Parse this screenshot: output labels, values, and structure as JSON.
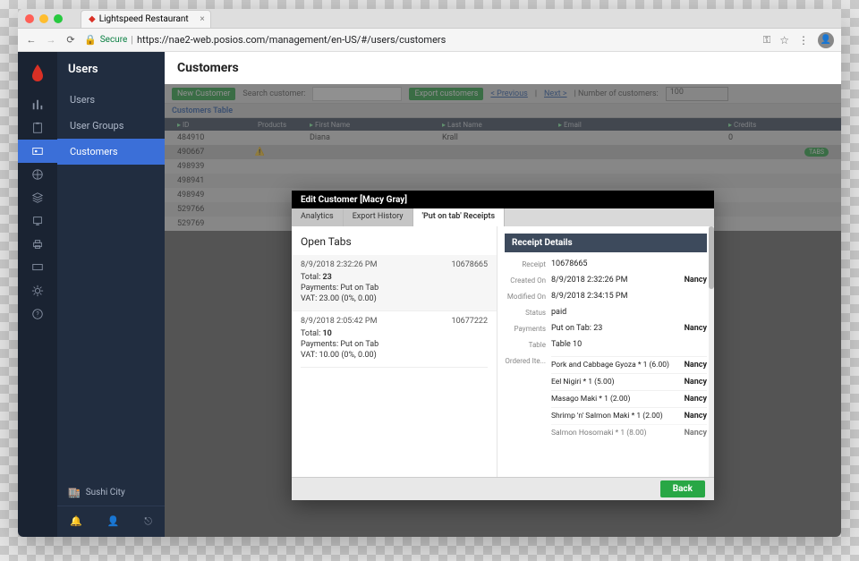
{
  "browser": {
    "tab_title": "Lightspeed Restaurant",
    "secure_label": "Secure",
    "url": "https://nae2-web.posios.com/management/en-US/#/users/customers"
  },
  "sidebar": {
    "title": "Users",
    "items": [
      "Users",
      "User Groups",
      "Customers"
    ],
    "active_index": 2,
    "footer_store": "Sushi City"
  },
  "page": {
    "title": "Customers",
    "new_button": "New Customer",
    "search_label": "Search customer:",
    "export_button": "Export customers",
    "prev_label": "< Previous",
    "next_label": "Next >",
    "count_label": "| Number of customers:",
    "per_page": "100",
    "table_title": "Customers Table",
    "columns": {
      "id": "ID",
      "products": "Products",
      "first": "First Name",
      "last": "Last Name",
      "email": "Email",
      "credits": "Credits"
    }
  },
  "rows": [
    {
      "id": "484910",
      "products": "",
      "first": "Diana",
      "last": "Krall",
      "email": "",
      "credits": "0",
      "badge": ""
    },
    {
      "id": "490667",
      "products": "warn",
      "first": "",
      "last": "",
      "email": "",
      "credits": "",
      "badge": "TABS"
    },
    {
      "id": "498939",
      "products": "",
      "first": "",
      "last": "",
      "email": "",
      "credits": "",
      "badge": ""
    },
    {
      "id": "498941",
      "products": "",
      "first": "",
      "last": "",
      "email": "",
      "credits": "",
      "badge": ""
    },
    {
      "id": "498949",
      "products": "",
      "first": "",
      "last": "",
      "email": "",
      "credits": "",
      "badge": ""
    },
    {
      "id": "529766",
      "products": "",
      "first": "",
      "last": "",
      "email": "",
      "credits": "",
      "badge": ""
    },
    {
      "id": "529769",
      "products": "",
      "first": "",
      "last": "",
      "email": "",
      "credits": "",
      "badge": ""
    }
  ],
  "modal": {
    "title": "Edit Customer [Macy Gray]",
    "tabs": [
      "Analytics",
      "Export History",
      "'Put on tab' Receipts"
    ],
    "active_tab": 2,
    "open_tabs_title": "Open Tabs",
    "receipts": [
      {
        "time": "8/9/2018 2:32:26 PM",
        "id": "10678665",
        "total_label": "Total:",
        "total": "23",
        "payments": "Payments: Put on Tab",
        "vat": "VAT: 23.00 (0%, 0.00)"
      },
      {
        "time": "8/9/2018 2:05:42 PM",
        "id": "10677222",
        "total_label": "Total:",
        "total": "10",
        "payments": "Payments: Put on Tab",
        "vat": "VAT: 10.00 (0%, 0.00)"
      }
    ],
    "details": {
      "head": "Receipt Details",
      "labels": {
        "receipt": "Receipt",
        "created": "Created On",
        "modified": "Modified On",
        "status": "Status",
        "payments": "Payments",
        "table": "Table",
        "ordered": "Ordered Ite..."
      },
      "receipt": "10678665",
      "created_on": "8/9/2018 2:32:26 PM",
      "created_by": "Nancy",
      "modified_on": "8/9/2018 2:34:15 PM",
      "status": "paid",
      "payments": "Put on Tab: 23",
      "payments_by": "Nancy",
      "table": "Table 10",
      "ordered_items": [
        {
          "desc": "Pork and Cabbage Gyoza * 1 (6.00)",
          "who": "Nancy"
        },
        {
          "desc": "Eel Nigiri * 1 (5.00)",
          "who": "Nancy"
        },
        {
          "desc": "Masago Maki * 1 (2.00)",
          "who": "Nancy"
        },
        {
          "desc": "Shrimp 'n' Salmon Maki * 1 (2.00)",
          "who": "Nancy"
        },
        {
          "desc": "Salmon Hosomaki * 1 (8.00)",
          "who": "Nancy"
        }
      ]
    },
    "back_label": "Back"
  }
}
